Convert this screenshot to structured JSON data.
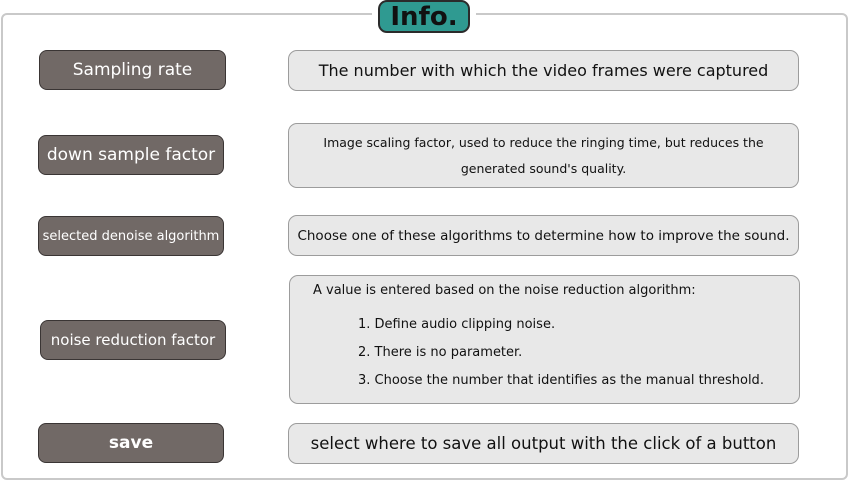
{
  "header": {
    "title": "Info."
  },
  "rows": [
    {
      "label": "Sampling rate",
      "description": "The number with which the video frames were captured"
    },
    {
      "label": "down sample factor",
      "description": "Image scaling factor, used to reduce the ringing time, but reduces the generated sound's quality."
    },
    {
      "label": "selected denoise algorithm",
      "description": "Choose one of these algorithms to determine how to improve the sound."
    },
    {
      "label": "noise reduction factor",
      "description": "A value is entered based on the noise reduction algorithm:",
      "options": [
        "1. Define audio clipping noise.",
        "2. There is no parameter.",
        "3. Choose the number that identifies as the manual threshold."
      ]
    },
    {
      "label": "save",
      "description": "select where to save all output with the click of a button"
    }
  ],
  "colors": {
    "title_badge": "#2f9a91",
    "label_button": "#716966",
    "description_box": "#e8e8e8",
    "frame_border": "#c9c9c9"
  }
}
